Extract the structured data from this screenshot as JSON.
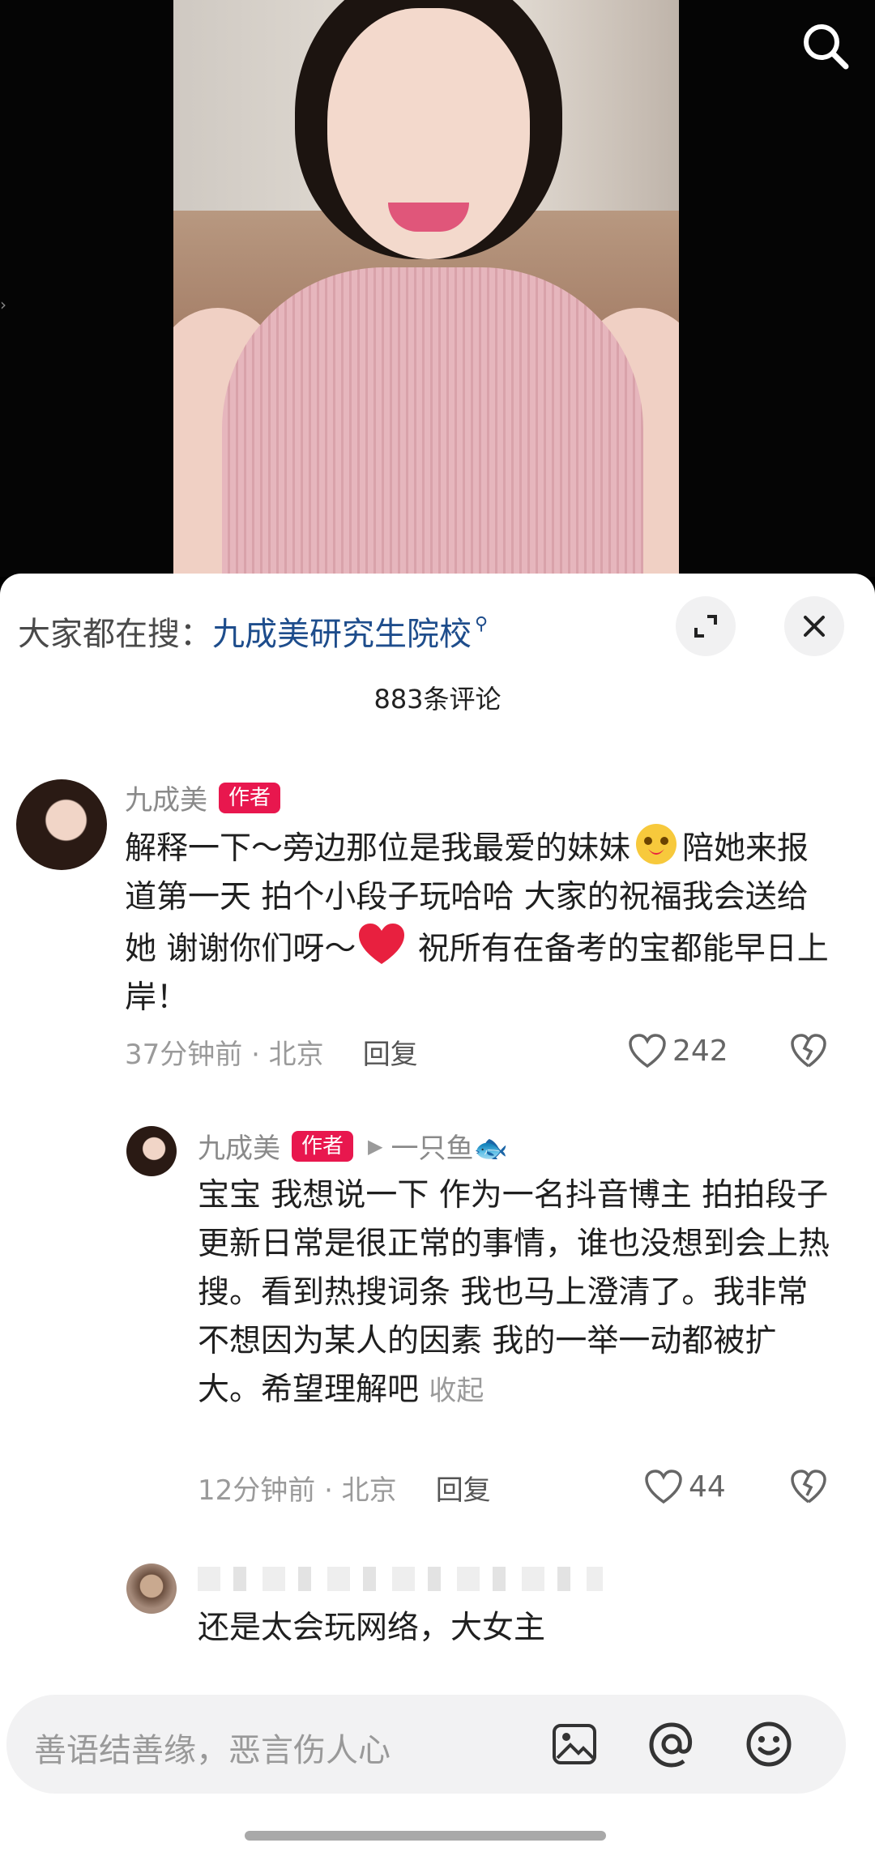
{
  "hot_search": {
    "prefix": "大家都在搜：",
    "keyword": "九成美研究生院校"
  },
  "comments_count": "883条评论",
  "comments": [
    {
      "author": "九成美",
      "badge": "作者",
      "text_parts": [
        "解释一下～旁边那位是我最爱的妹妹",
        "陪她来报道第一天 拍个小段子玩哈哈 大家的祝福我会送给她 谢谢你们呀～",
        " 祝所有在备考的宝都能早日上岸！"
      ],
      "time_location": "37分钟前 · 北京",
      "reply_label": "回复",
      "likes": "242"
    },
    {
      "author": "九成美",
      "badge": "作者",
      "reply_to": "一只鱼🐟",
      "text": "宝宝 我想说一下 作为一名抖音博主 拍拍段子更新日常是很正常的事情，谁也没想到会上热搜。看到热搜词条 我也马上澄清了。我非常不想因为某人的因素 我的一举一动都被扩大。希望理解吧",
      "collapse_label": "收起",
      "time_location": "12分钟前 · 北京",
      "reply_label": "回复",
      "likes": "44"
    },
    {
      "text": "还是太会玩网络，大女主"
    }
  ],
  "input": {
    "placeholder": "善语结善缘，恶言伤人心"
  },
  "colors": {
    "author_badge": "#e8174e",
    "hot_keyword": "#1e4d8c",
    "heart_red": "#e8203f"
  },
  "icons": [
    "search-icon",
    "expand-icon",
    "close-icon",
    "heart-outline-icon",
    "broken-heart-icon",
    "image-icon",
    "at-icon",
    "smile-icon"
  ]
}
